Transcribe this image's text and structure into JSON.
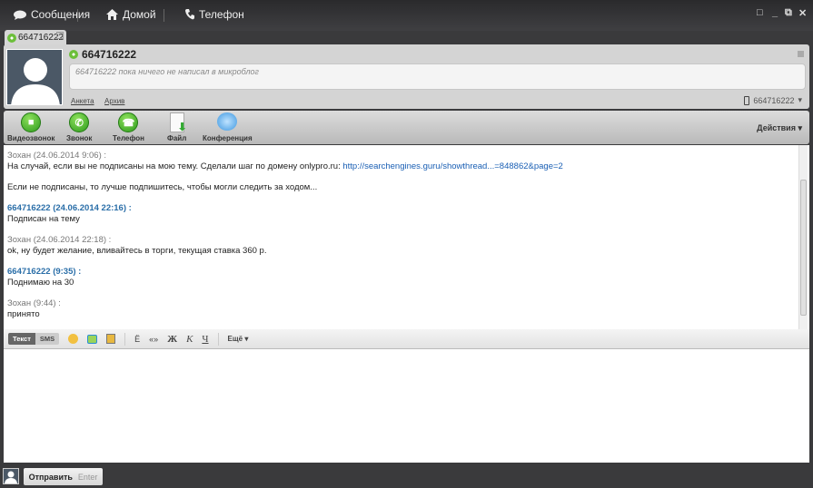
{
  "top_tabs": [
    {
      "label": "Сообщения",
      "icon": "chat-bubble-icon"
    },
    {
      "label": "Домой",
      "icon": "home-icon"
    },
    {
      "label": "Телефон",
      "icon": "phone-icon"
    }
  ],
  "window_controls": [
    "□",
    "_",
    "⧉",
    "✕"
  ],
  "chat_tab": {
    "label": "664716222"
  },
  "contact": {
    "name": "664716222",
    "status": "664716222 пока ничего не написал в микроблог",
    "links": [
      "Анкета",
      "Архив"
    ],
    "phone_selector": "664716222"
  },
  "toolbar": {
    "buttons": [
      "Видеозвонок",
      "Звонок",
      "Телефон",
      "Файл",
      "Конференция"
    ],
    "actions": "Действия"
  },
  "messages": [
    {
      "header": "Зохан (24.06.2014 9:06) :",
      "me": false,
      "lines": [
        "На случай, если вы не подписаны на мою тему. Сделали шаг по домену onlypro.ru: "
      ],
      "link": "http://searchengines.guru/showthread...=848862&page=2"
    },
    {
      "header": "",
      "me": false,
      "lines": [
        "Если не подписаны, то лучше подпишитесь, чтобы могли следить за ходом..."
      ]
    },
    {
      "header": "664716222 (24.06.2014 22:16) :",
      "me": true,
      "lines": [
        "Подписан на тему"
      ]
    },
    {
      "header": "Зохан (24.06.2014 22:18) :",
      "me": false,
      "lines": [
        "ok, ну будет желание, вливайтесь в торги, текущая ставка 360 р."
      ]
    },
    {
      "header": "664716222 (9:35) :",
      "me": true,
      "lines": [
        "Поднимаю на 30"
      ]
    },
    {
      "header": "Зохан (9:44) :",
      "me": false,
      "lines": [
        "принято"
      ]
    }
  ],
  "format": {
    "mode_text": "Текст",
    "mode_sms": "SMS",
    "bold": "Ж",
    "italic": "К",
    "underline": "Ч",
    "quote": "«»",
    "translit": "Ё",
    "more": "Ещё"
  },
  "send": {
    "label": "Отправить",
    "hint": "Enter"
  }
}
